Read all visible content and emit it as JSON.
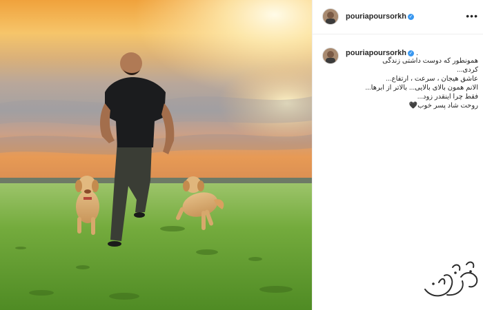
{
  "post": {
    "username": "pouriapoursorkh",
    "verified_mark": "✓",
    "more_icon": "more-options-icon",
    "caption_suffix": ".",
    "caption_lines": [
      "همونطور که دوست داشتی زندگی",
      "کردی...",
      "عاشق هیجان ، سرعت ، ارتفاع...",
      "الانم همون بالای بالایی... بالاتر از ابرها...",
      "فقط چرا اینقدر زود...",
      "روحت شاد پسر خوب🖤"
    ]
  },
  "colors": {
    "verified": "#3897f0",
    "sky_top": "#e88b2a",
    "grass": "#5f9d2e"
  },
  "watermark": {
    "icon": "site-logo-watermark"
  }
}
